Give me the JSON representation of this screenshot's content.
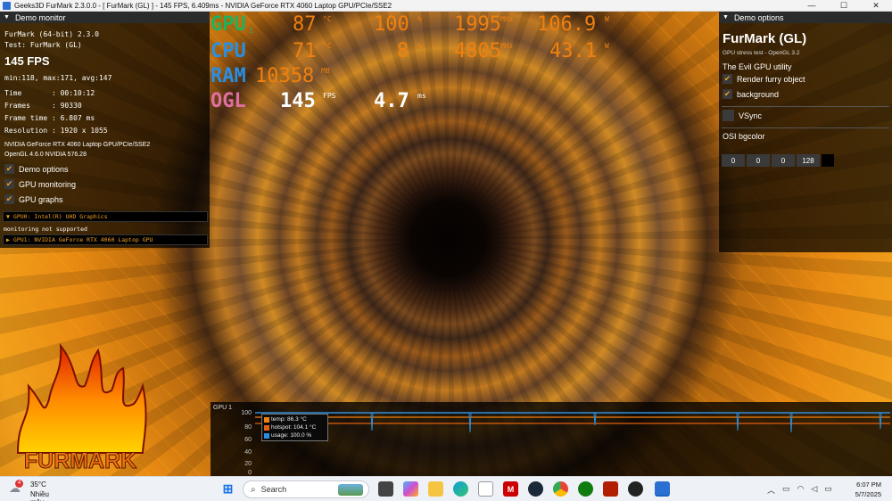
{
  "window": {
    "title": "Geeks3D FurMark 2.3.0.0 - [ FurMark (GL) ] - 145 FPS, 6.409ms - NVIDIA GeForce RTX 4060 Laptop GPU/PCIe/SSE2",
    "icon": "app-icon"
  },
  "window_buttons": [
    "—",
    "☐",
    "✕"
  ],
  "left_panel": {
    "header": "Demo monitor",
    "lines": [
      "FurMark (64-bit) 2.3.0",
      "Test: FurMark (GL)"
    ],
    "fps": "145 FPS",
    "stats": "min:118, max:171, avg:147",
    "info": [
      "Time       : 00:10:12",
      "Frames     : 90330",
      "Frame time : 6.807 ms",
      "Resolution : 1920 x 1055"
    ],
    "gpu_lines": [
      "NVIDIA GeForce RTX 4060 Laptop GPU/PCIe/SSE2",
      "OpenGL 4.6.0 NVIDIA 576.28"
    ],
    "checkboxes": [
      "Demo options",
      "GPU monitoring",
      "GPU graphs"
    ],
    "gpu0": "GPU0: Intel(R) UHD Graphics",
    "gpu0_note": "monitoring not supported",
    "gpu1": "GPU1: NVIDIA GeForce RTX 4060 Laptop GPU"
  },
  "right_panel": {
    "header": "Demo options",
    "title": "FurMark (GL)",
    "subtitle": "GPU stress test - OpenGL 3.2",
    "tagline": "The Evil GPU utility",
    "checks": [
      "Render furry object",
      "background"
    ],
    "vsync": "VSync",
    "bgcolor_label": "OSI bgcolor",
    "bgcolor_values": [
      "0",
      "0",
      "0",
      "128"
    ]
  },
  "hud": {
    "rows": [
      {
        "label": "GPU",
        "sub": "1",
        "v1": "87",
        "u1": "°C",
        "v2": "100",
        "u2": "%",
        "v3": "1995",
        "u3": "MHz",
        "v4": "106.9",
        "u4": "W"
      },
      {
        "label": "CPU",
        "v1": "71",
        "u1": "°C",
        "v2": "8",
        "u2": "%",
        "v3": "4805",
        "u3": "MHz",
        "v4": "43.1",
        "u4": "W"
      },
      {
        "label": "RAM",
        "v1": "10358",
        "u1": "MB"
      },
      {
        "label": "OGL",
        "v1": "145",
        "u1": "FPS",
        "v2": "4.7",
        "u2": "ms"
      }
    ],
    "colors": {
      "label": "#1fb25a",
      "value": "#f08010",
      "white": "#ffffff"
    }
  },
  "graph": {
    "label": "GPU 1",
    "yticks": [
      "100",
      "80",
      "60",
      "40",
      "20",
      "0"
    ],
    "legend": [
      {
        "name": "temp: 86.3 °C",
        "color": "#f08010"
      },
      {
        "name": "hotspot: 104.1 °C",
        "color": "#e06010"
      },
      {
        "name": "usage: 100.0 %",
        "color": "#2a8fe0"
      }
    ]
  },
  "logo_text": "FURMARK",
  "taskbar": {
    "weather_temp": "35°C",
    "weather_desc": "Nhiều mây",
    "search": "Search",
    "time": "6:07 PM",
    "date": "5/7/2025",
    "badge": "4",
    "apps": [
      "start-icon",
      "task-view-icon",
      "copilot-icon",
      "file-explorer-icon",
      "edge-icon",
      "store-icon",
      "mcafee-icon",
      "steam-icon",
      "chrome-icon",
      "xbox-icon",
      "furmark-icon",
      "obs-icon",
      "app-window-icon"
    ]
  }
}
